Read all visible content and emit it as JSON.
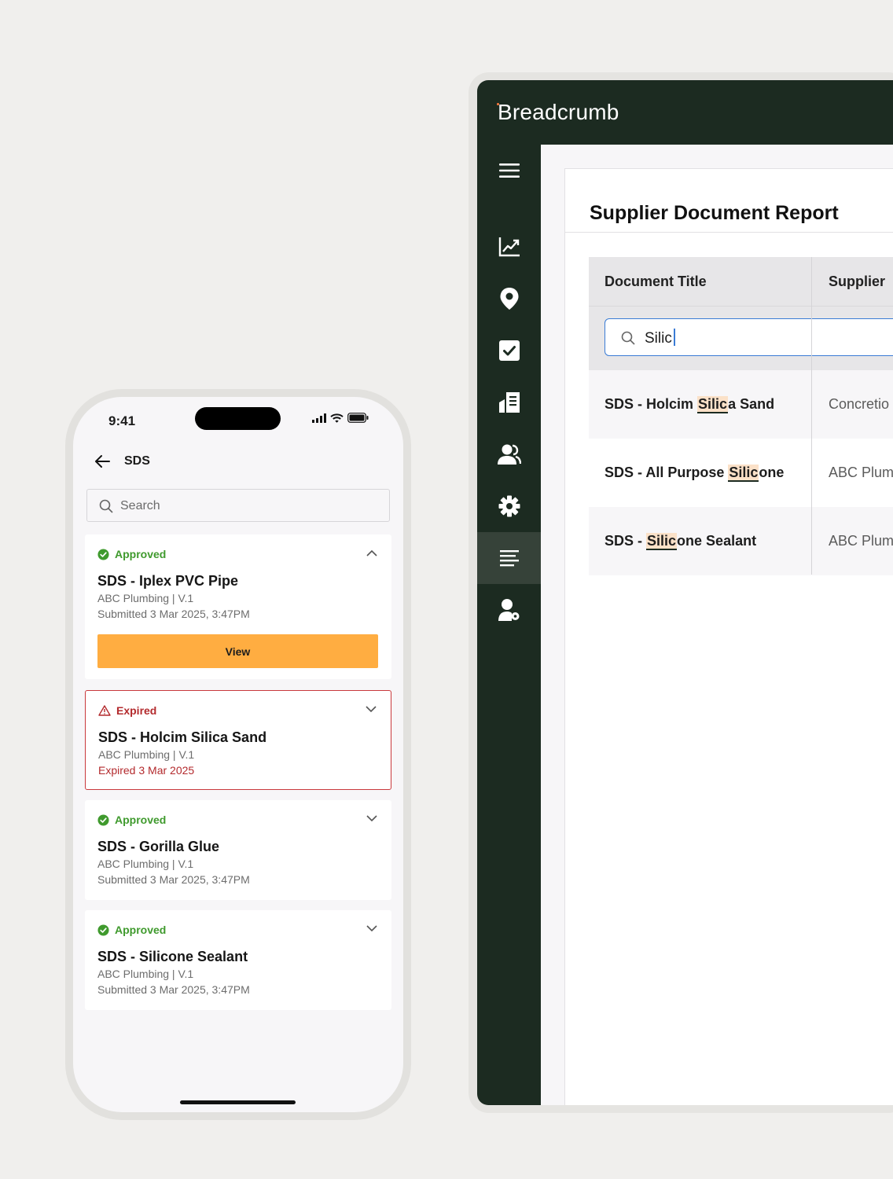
{
  "desktop": {
    "brand": "Breadcrumb",
    "nav": [
      {
        "icon": "menu-icon"
      },
      {
        "icon": "chart-icon"
      },
      {
        "icon": "location-pin-icon"
      },
      {
        "icon": "checkbox-icon"
      },
      {
        "icon": "document-icon"
      },
      {
        "icon": "users-icon"
      },
      {
        "icon": "settings-gear-icon"
      },
      {
        "icon": "report-lines-icon",
        "active": true
      },
      {
        "icon": "user-settings-icon"
      }
    ],
    "page_title": "Supplier Document Report",
    "table": {
      "columns": [
        "Document Title",
        "Supplier"
      ],
      "filter_value": "Silic",
      "rows": [
        {
          "title_pre": "SDS - Holcim ",
          "title_hl": "Silic",
          "title_post": "a Sand",
          "supplier": "Concretio"
        },
        {
          "title_pre": "SDS - All Purpose ",
          "title_hl": "Silic",
          "title_post": "one",
          "supplier": "ABC Plum"
        },
        {
          "title_pre": "SDS - ",
          "title_hl": "Silic",
          "title_post": "one Sealant",
          "supplier": "ABC Plum"
        }
      ]
    },
    "colors": {
      "sidebar": "#1c2b21",
      "highlight": "#fbe1c8",
      "focus": "#3a7bd5"
    }
  },
  "phone": {
    "time": "9:41",
    "screen_title": "SDS",
    "search_placeholder": "Search",
    "cards": [
      {
        "status": "Approved",
        "title": "SDS - Iplex PVC Pipe",
        "supplier": "ABC Plumbing",
        "version": "V.1",
        "date_line": "Submitted 3 Mar 2025, 3:47PM",
        "expanded": true,
        "button": "View"
      },
      {
        "status": "Expired",
        "title": "SDS - Holcim Silica Sand",
        "supplier": "ABC Plumbing",
        "version": "V.1",
        "date_line": "Expired 3 Mar 2025"
      },
      {
        "status": "Approved",
        "title": "SDS - Gorilla Glue",
        "supplier": "ABC Plumbing",
        "version": "V.1",
        "date_line": "Submitted 3 Mar 2025, 3:47PM"
      },
      {
        "status": "Approved",
        "title": "SDS - Silicone Sealant",
        "supplier": "ABC Plumbing",
        "version": "V.1",
        "date_line": "Submitted 3 Mar 2025, 3:47PM"
      }
    ],
    "colors": {
      "approved": "#3f9a2d",
      "expired": "#b32a2d",
      "button": "#ffad41"
    }
  }
}
